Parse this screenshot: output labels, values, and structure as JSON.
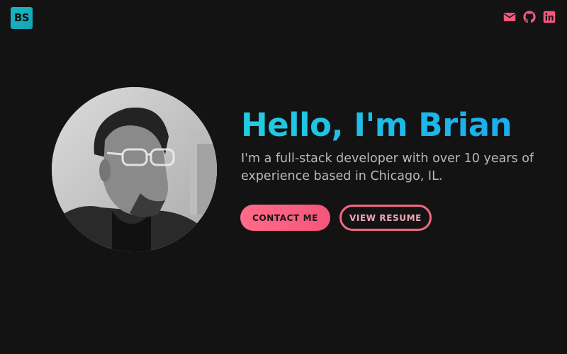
{
  "header": {
    "logo_text": "BS",
    "social_icons": [
      "mail-icon",
      "github-icon",
      "linkedin-icon"
    ],
    "icon_color": "#f6587b"
  },
  "hero": {
    "avatar_alt": "Portrait of Brian",
    "headline": "Hello, I'm Brian",
    "subtitle": "I'm a full-stack developer with over 10 years of experience based in Chicago, IL.",
    "contact_button": "CONTACT ME",
    "resume_button": "VIEW RESUME"
  },
  "colors": {
    "background": "#141314",
    "accent_cyan": "#1ec3e3",
    "accent_pink": "#f6587b",
    "logo_bg": "#17b8c4"
  }
}
